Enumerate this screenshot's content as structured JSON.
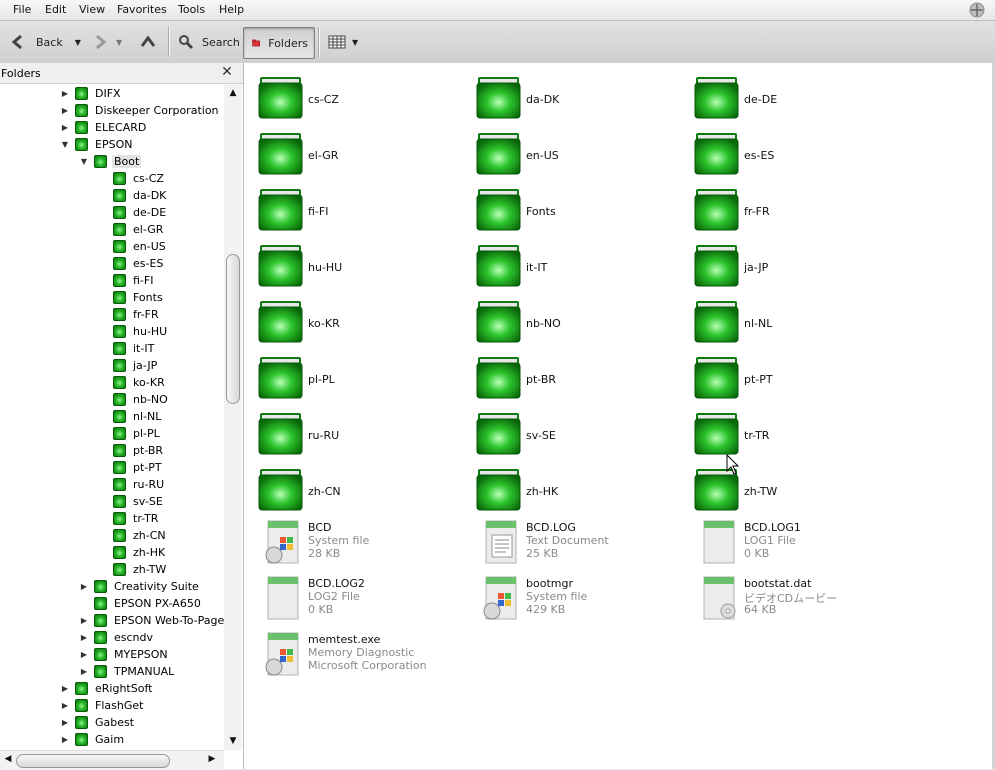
{
  "menu": {
    "file": "File",
    "edit": "Edit",
    "view": "View",
    "favorites": "Favorites",
    "tools": "Tools",
    "help": "Help"
  },
  "toolbar": {
    "back": "Back",
    "search": "Search",
    "folders": "Folders"
  },
  "pane": {
    "title": "Folders",
    "close": "✕"
  },
  "tree": [
    {
      "label": "DIFX",
      "depth": 0,
      "exp": "▶"
    },
    {
      "label": "Diskeeper Corporation",
      "depth": 0,
      "exp": "▶"
    },
    {
      "label": "ELECARD",
      "depth": 0,
      "exp": "▶"
    },
    {
      "label": "EPSON",
      "depth": 0,
      "exp": "▼"
    },
    {
      "label": "Boot",
      "depth": 1,
      "exp": "▼",
      "selected": true
    },
    {
      "label": "cs-CZ",
      "depth": 2,
      "exp": ""
    },
    {
      "label": "da-DK",
      "depth": 2,
      "exp": ""
    },
    {
      "label": "de-DE",
      "depth": 2,
      "exp": ""
    },
    {
      "label": "el-GR",
      "depth": 2,
      "exp": ""
    },
    {
      "label": "en-US",
      "depth": 2,
      "exp": ""
    },
    {
      "label": "es-ES",
      "depth": 2,
      "exp": ""
    },
    {
      "label": "fi-FI",
      "depth": 2,
      "exp": ""
    },
    {
      "label": "Fonts",
      "depth": 2,
      "exp": ""
    },
    {
      "label": "fr-FR",
      "depth": 2,
      "exp": ""
    },
    {
      "label": "hu-HU",
      "depth": 2,
      "exp": ""
    },
    {
      "label": "it-IT",
      "depth": 2,
      "exp": ""
    },
    {
      "label": "ja-JP",
      "depth": 2,
      "exp": ""
    },
    {
      "label": "ko-KR",
      "depth": 2,
      "exp": ""
    },
    {
      "label": "nb-NO",
      "depth": 2,
      "exp": ""
    },
    {
      "label": "nl-NL",
      "depth": 2,
      "exp": ""
    },
    {
      "label": "pl-PL",
      "depth": 2,
      "exp": ""
    },
    {
      "label": "pt-BR",
      "depth": 2,
      "exp": ""
    },
    {
      "label": "pt-PT",
      "depth": 2,
      "exp": ""
    },
    {
      "label": "ru-RU",
      "depth": 2,
      "exp": ""
    },
    {
      "label": "sv-SE",
      "depth": 2,
      "exp": ""
    },
    {
      "label": "tr-TR",
      "depth": 2,
      "exp": ""
    },
    {
      "label": "zh-CN",
      "depth": 2,
      "exp": ""
    },
    {
      "label": "zh-HK",
      "depth": 2,
      "exp": ""
    },
    {
      "label": "zh-TW",
      "depth": 2,
      "exp": ""
    },
    {
      "label": "Creativity Suite",
      "depth": 1,
      "exp": "▶"
    },
    {
      "label": "EPSON PX-A650",
      "depth": 1,
      "exp": ""
    },
    {
      "label": "EPSON Web-To-Page",
      "depth": 1,
      "exp": "▶"
    },
    {
      "label": "escndv",
      "depth": 1,
      "exp": "▶"
    },
    {
      "label": "MYEPSON",
      "depth": 1,
      "exp": "▶"
    },
    {
      "label": "TPMANUAL",
      "depth": 1,
      "exp": "▶"
    },
    {
      "label": "eRightSoft",
      "depth": 0,
      "exp": "▶"
    },
    {
      "label": "FlashGet",
      "depth": 0,
      "exp": "▶"
    },
    {
      "label": "Gabest",
      "depth": 0,
      "exp": "▶"
    },
    {
      "label": "Gaim",
      "depth": 0,
      "exp": "▶"
    }
  ],
  "folders": [
    "cs-CZ",
    "da-DK",
    "de-DE",
    "el-GR",
    "en-US",
    "es-ES",
    "fi-FI",
    "Fonts",
    "fr-FR",
    "hu-HU",
    "it-IT",
    "ja-JP",
    "ko-KR",
    "nb-NO",
    "nl-NL",
    "pl-PL",
    "pt-BR",
    "pt-PT",
    "ru-RU",
    "sv-SE",
    "tr-TR",
    "zh-CN",
    "zh-HK",
    "zh-TW"
  ],
  "files": [
    {
      "name": "BCD",
      "type": "System file",
      "size": "28 KB",
      "icon": "system-file-icon"
    },
    {
      "name": "BCD.LOG",
      "type": "Text Document",
      "size": "25 KB",
      "icon": "text-document-icon"
    },
    {
      "name": "BCD.LOG1",
      "type": "LOG1 File",
      "size": "0 KB",
      "icon": "generic-file-icon"
    },
    {
      "name": "BCD.LOG2",
      "type": "LOG2 File",
      "size": "0 KB",
      "icon": "generic-file-icon"
    },
    {
      "name": "bootmgr",
      "type": "System file",
      "size": "429 KB",
      "icon": "system-file-icon"
    },
    {
      "name": "bootstat.dat",
      "type": "ビデオCDムービー",
      "size": "64 KB",
      "icon": "video-cd-file-icon"
    },
    {
      "name": "memtest.exe",
      "type": "Memory Diagnostic",
      "size": "Microsoft Corporation",
      "icon": "executable-icon"
    }
  ]
}
